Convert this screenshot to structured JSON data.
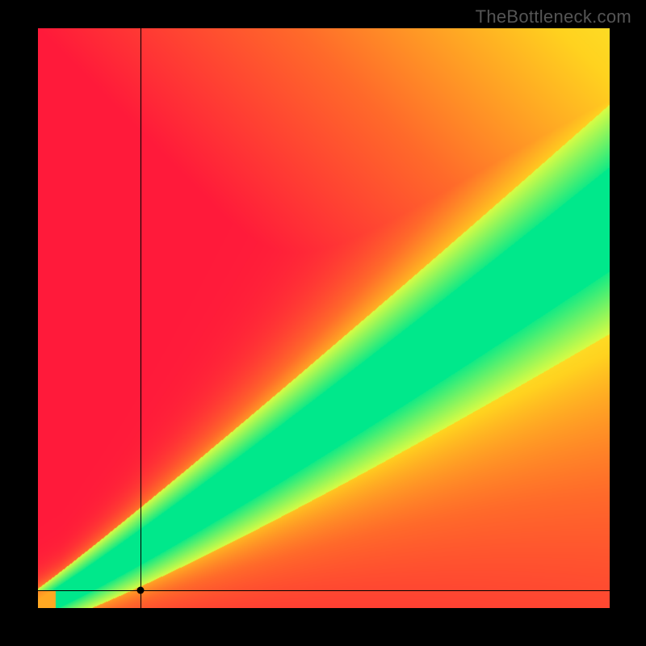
{
  "watermark": "TheBottleneck.com",
  "chart_data": {
    "type": "heatmap",
    "title": "",
    "xlabel": "",
    "ylabel": "",
    "xlim": [
      0,
      100
    ],
    "ylim": [
      0,
      100
    ],
    "crosshair": {
      "x": 18,
      "y": 3
    },
    "optimal_band": {
      "description": "Green diagonal band indicating balanced performance; warmer colors (yellow/red) indicate bottleneck regions.",
      "slope_approx": 0.67,
      "intercept_approx": 0,
      "band_width_pct": 8
    },
    "color_scale": [
      "#ff1a3a",
      "#ff6a2a",
      "#ffd21f",
      "#f6ff3a",
      "#00e88b"
    ],
    "grid": false,
    "legend": false
  }
}
